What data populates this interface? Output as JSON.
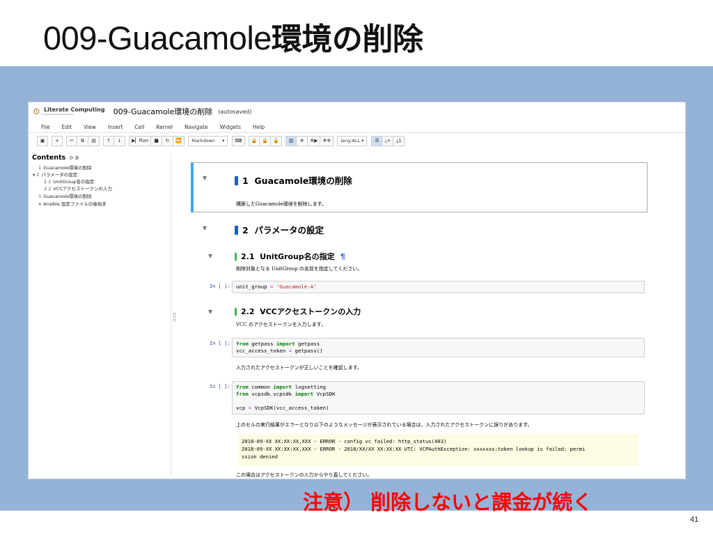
{
  "slide": {
    "title_en": "009-Guacamole",
    "title_jp": "環境の削除",
    "notice": "注意） 削除しないと課金が続く",
    "page_number": "41"
  },
  "notebook": {
    "logo_text": "Literate Computing",
    "logo_sub": "for Reproducible Infrastructure",
    "name": "009-Guacamole環境の削除",
    "autosaved": "(autosaved)",
    "menu": [
      "File",
      "Edit",
      "View",
      "Insert",
      "Cell",
      "Kernel",
      "Navigate",
      "Widgets",
      "Help"
    ],
    "toolbar": {
      "run_label": "Run",
      "cell_type": "Markdown",
      "lang": "lang:ALL"
    }
  },
  "toc": {
    "title": "Contents",
    "items": [
      {
        "num": "1",
        "label": "Guacamole環境の削除"
      },
      {
        "num": "2",
        "label": "パラメータの設定"
      },
      {
        "num": "2.1",
        "label": "UnitGroup名の指定"
      },
      {
        "num": "2.2",
        "label": "VCCアクセストークンの入力"
      },
      {
        "num": "3",
        "label": "Guacamole環境の削除"
      },
      {
        "num": "4",
        "label": "Ansible 設定ファイルの後始末"
      }
    ]
  },
  "cells": {
    "h1_1": {
      "num": "1",
      "title": "Guacamole環境の削除",
      "desc": "構築したGuacamole環境を削除します。"
    },
    "h1_2": {
      "num": "2",
      "title": "パラメータの設定"
    },
    "h2_1": {
      "num": "2.1",
      "title": "UnitGroup名の指定",
      "pilcrow": "¶",
      "desc": "削除対象となる UnitGroup の名前を指定してください。"
    },
    "code1": {
      "prompt": "In [ ]:",
      "lines": [
        {
          "a": "unit_group ",
          "b": "=",
          "c": " ",
          "d": "'Guacamole-A'"
        }
      ]
    },
    "h2_2": {
      "num": "2.2",
      "title": "VCCアクセストークンの入力",
      "desc": "VCC のアクセストークンを入力します。"
    },
    "code2": {
      "prompt": "In [ ]:",
      "lines": [
        "from",
        " getpass ",
        "import",
        " getpass",
        "vcc_access_token ",
        "=",
        " getpass()"
      ]
    },
    "desc3": "入力されたアクセストークンが正しいことを確認します。",
    "code3": {
      "prompt": "In [ ]:",
      "l1a": "from",
      "l1b": " common ",
      "l1c": "import",
      "l1d": " logsetting",
      "l2a": "from",
      "l2b": " vcpsdk.vcpsdk ",
      "l2c": "import",
      "l2d": " VcpSDK",
      "l3a": "vcp ",
      "l3b": "=",
      "l3c": " VcpSDK(vcc_access_token)"
    },
    "desc4": "上のセルの実行結果がエラーとなり以下のようなメッセージが表示されている場合は、入力されたアクセストークンに誤りがあります。",
    "output": [
      "2018-09-XX XX:XX:XX,XXX - ERROR - config vc failed: http_status(403)",
      "2018-09-XX XX:XX:XX,XXX - ERROR - 2018/XX/XX XX:XX:XX UTC: VCPAuthException: xxxxxxx:token lookup is failed: permi",
      "ssion denied"
    ],
    "desc5": "この場合はアクセストークンの入力からやり直してください。"
  },
  "colors": {
    "band": "#95b3d7",
    "h1_bar": "#1f5fbf",
    "h2_bar": "#4caf50",
    "selected_border": "#42a5f5",
    "notice": "#ff0000"
  }
}
